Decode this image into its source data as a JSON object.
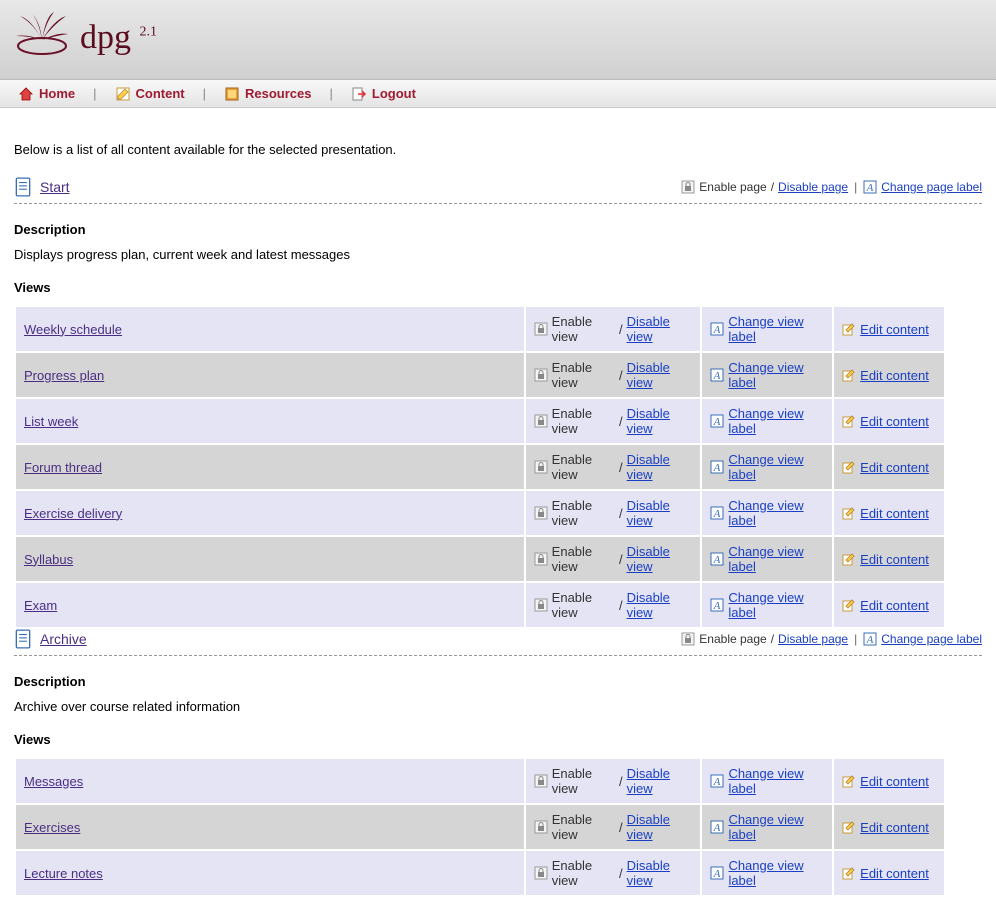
{
  "app": {
    "name": "dpg",
    "version": "2.1"
  },
  "nav": {
    "home": "Home",
    "content": "Content",
    "resources": "Resources",
    "logout": "Logout"
  },
  "intro": "Below is a list of all content available for the selected presentation.",
  "labels": {
    "description": "Description",
    "views": "Views",
    "enable_page": "Enable page",
    "disable_page": "Disable page",
    "change_page_label": "Change page label",
    "enable_view": "Enable view",
    "disable_view": "Disable view",
    "change_view_label": "Change view label",
    "edit_content": "Edit content",
    "slash": " / "
  },
  "pages": [
    {
      "title": "Start",
      "description": "Displays progress plan, current week and latest messages",
      "views": [
        {
          "name": "Weekly schedule"
        },
        {
          "name": "Progress plan"
        },
        {
          "name": "List week"
        },
        {
          "name": "Forum thread"
        },
        {
          "name": "Exercise delivery"
        },
        {
          "name": "Syllabus"
        },
        {
          "name": "Exam"
        }
      ]
    },
    {
      "title": "Archive",
      "description": "Archive over course related information",
      "views": [
        {
          "name": "Messages"
        },
        {
          "name": "Exercises"
        },
        {
          "name": "Lecture notes"
        }
      ]
    }
  ]
}
